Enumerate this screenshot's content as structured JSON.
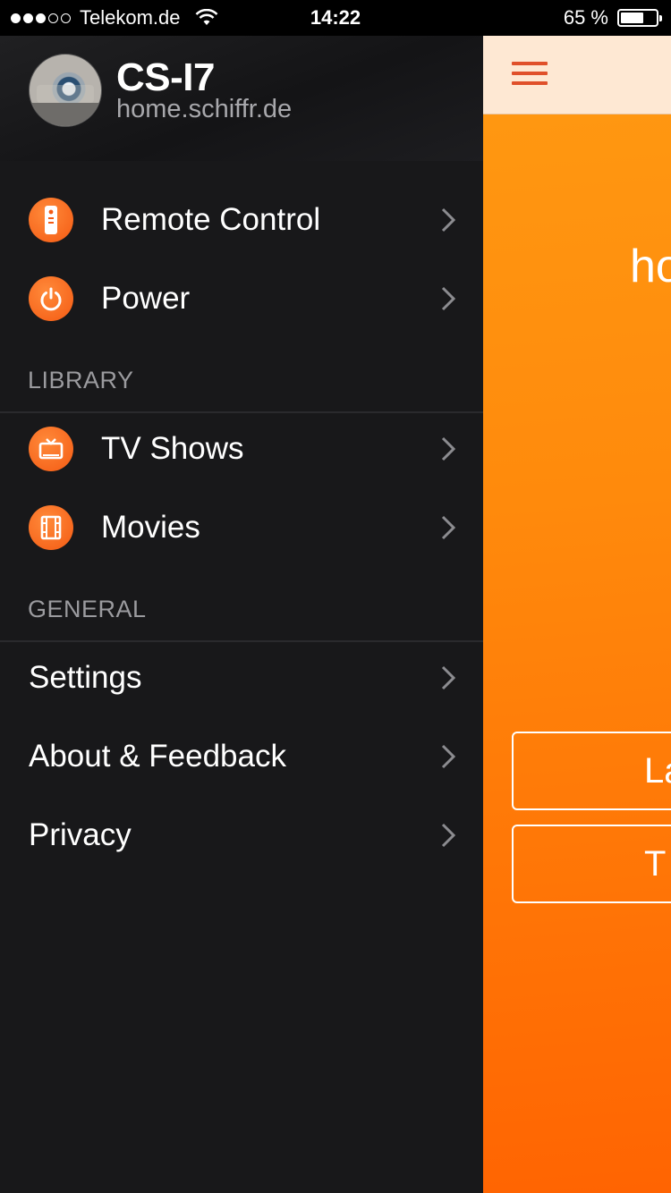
{
  "status_bar": {
    "signal_dots_filled": 3,
    "signal_dots_total": 5,
    "carrier": "Telekom.de",
    "time": "14:22",
    "battery_text": "65 %",
    "battery_level": 0.65
  },
  "drawer": {
    "device_name": "CS-I7",
    "device_host": "home.schiffr.de",
    "items": [
      {
        "label": "Remote Control",
        "icon": "remote-icon"
      },
      {
        "label": "Power",
        "icon": "power-icon"
      }
    ],
    "sections": [
      {
        "title": "LIBRARY",
        "items": [
          {
            "label": "TV Shows",
            "icon": "tv-icon"
          },
          {
            "label": "Movies",
            "icon": "film-icon"
          }
        ]
      },
      {
        "title": "GENERAL",
        "items": [
          {
            "label": "Settings"
          },
          {
            "label": "About & Feedback"
          },
          {
            "label": "Privacy"
          }
        ]
      }
    ]
  },
  "main": {
    "menu_icon": "hamburger-icon",
    "partial_text": "ho",
    "buttons": [
      {
        "label": "La"
      },
      {
        "label": "T"
      }
    ]
  },
  "colors": {
    "accent": "#f45a13",
    "drawer_bg": "#18181a",
    "nav_bar_bg": "#fee8d3",
    "main_gradient_top": "#ff9a12",
    "main_gradient_bottom": "#ff6402"
  }
}
